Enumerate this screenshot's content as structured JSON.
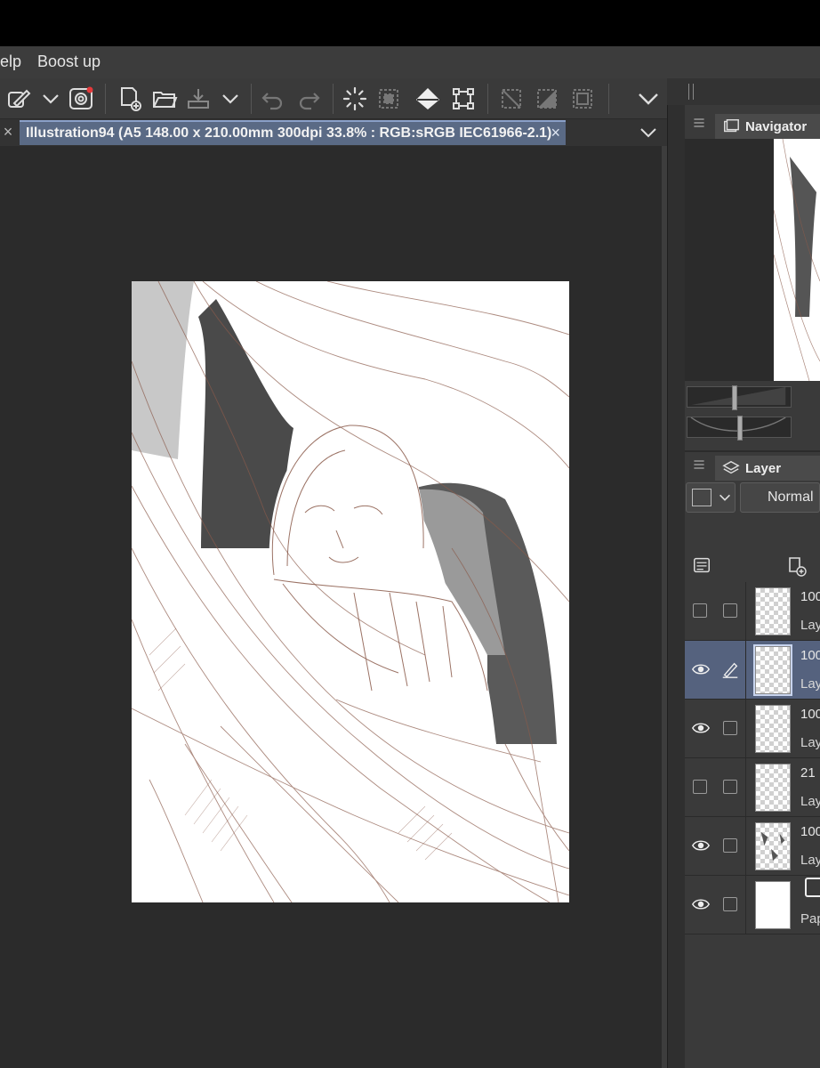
{
  "menu": {
    "help": "elp",
    "boost": "Boost up"
  },
  "document": {
    "tab_title": "Illustration94 (A5 148.00 x 210.00mm 300dpi 33.8% : RGB:sRGB IEC61966-2.1)",
    "close_glyph": "×"
  },
  "tab_left_close": "×",
  "navigator": {
    "title": "Navigator"
  },
  "layer_panel": {
    "title": "Layer",
    "blend_mode": "Normal"
  },
  "layers": [
    {
      "opacity": "100",
      "name": "Lay",
      "visible": false,
      "selected": false
    },
    {
      "opacity": "100",
      "name": "Lay",
      "visible": true,
      "selected": true
    },
    {
      "opacity": "100",
      "name": "Lay",
      "visible": true,
      "selected": false
    },
    {
      "opacity": "21",
      "name": "Lay",
      "visible": false,
      "selected": false
    },
    {
      "opacity": "100",
      "name": "Lay",
      "visible": true,
      "selected": false
    },
    {
      "opacity": "",
      "name": "Pap",
      "visible": true,
      "selected": false
    }
  ],
  "colors": {
    "accent": "#5a6a85",
    "selected_layer": "#55627e",
    "panel": "#3a3a3a",
    "canvas_bg": "#2b2b2b",
    "stroke": "#8a5a4a"
  }
}
